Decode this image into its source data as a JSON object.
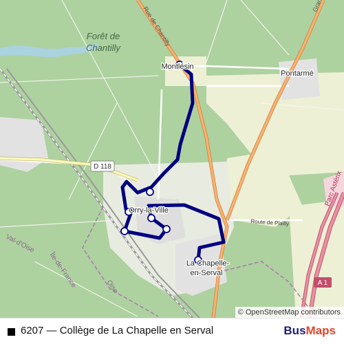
{
  "map": {
    "labels": {
      "forest_line1": "Forêt de",
      "forest_line2": "Chantilly",
      "rue_de_chantilly": "Rue de Chantilly",
      "d118": "D 118",
      "montlesin": "Montlésin",
      "pontarme": "Pontarmé",
      "orry_la_ville": "Orry-la-Ville",
      "route_de_plailly": "Route de Plailly",
      "la_chapelle_line1": "La Chapelle-",
      "la_chapelle_line2": "en-Serval",
      "val_doise": "Val-d'Oise",
      "ile_de_france": "Île-de-France",
      "oise": "Oise",
      "parc_asterix": "Parc Astérix",
      "a1": "A 1",
      "grand": "Grand"
    },
    "colors": {
      "forest": "#aed1a0",
      "clearing": "#f2efe9",
      "farmland": "#eef0d5",
      "route": "#000080",
      "major_road": "#f9b16e",
      "motorway": "#e892a2"
    }
  },
  "attribution": {
    "symbol": "©",
    "text": "OpenStreetMap contributors"
  },
  "footer": {
    "route_title": "6207 — Collège de La Chapelle en Serval",
    "logo_part1": "Bus",
    "logo_part2": "Maps"
  }
}
